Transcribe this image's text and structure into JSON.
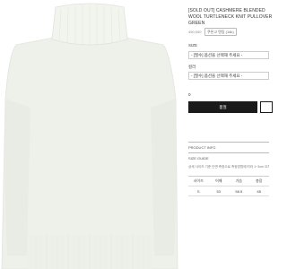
{
  "product": {
    "title": "[SOLD OUT] CASHMERE BLENDED WOOL TURTLENECK KNIT PULLOVER GREEN",
    "price": "490,000",
    "badge": "쿠폰고 텐팅 (14k)"
  },
  "options": {
    "size": {
      "label": "SIZE",
      "value": "- [필수] 옵션을 선택해 주세요 -"
    },
    "color": {
      "label": "컬러",
      "value": "- [필수] 옵션을 선택해 주세요 -"
    }
  },
  "quantity": "0",
  "actions": {
    "buy_label": "품절"
  },
  "sections": {
    "product_info": "PRODUCT INFO",
    "size_guide": "SIZE GUIDE",
    "guide_note": "상세 사이즈 기준 단면 측정으로 측정방법에 따라 1~3cm 오차가 있을 수 있습니다."
  },
  "size_table": {
    "headers": [
      "사이즈",
      "어깨",
      "가슴",
      "총장"
    ],
    "rows": [
      [
        "S",
        "53",
        "58.5",
        "65"
      ]
    ]
  },
  "colors": {
    "sweater": "#eef0ea",
    "button": "#1a1a1a"
  }
}
